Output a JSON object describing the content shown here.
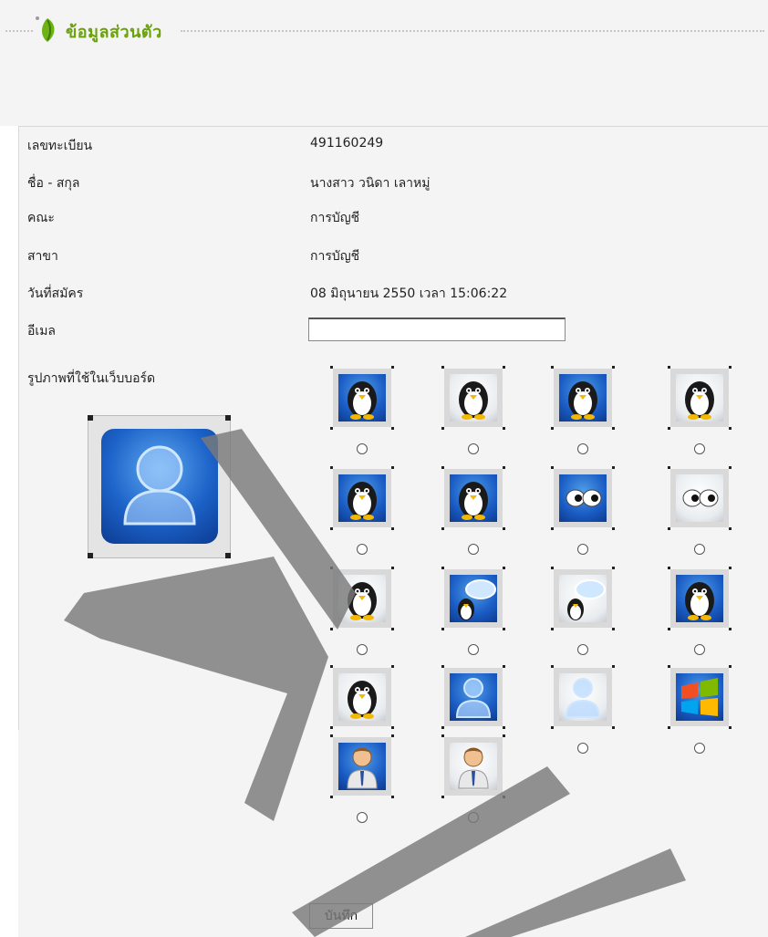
{
  "header": {
    "title": "ข้อมูลส่วนตัว"
  },
  "profile": {
    "fields": [
      {
        "label": "เลขทะเบียน",
        "value": "491160249"
      },
      {
        "label": "ชื่อ - สกุล",
        "value": "นางสาว วนิดา เลาหมู่"
      },
      {
        "label": "คณะ",
        "value": "การบัญชี"
      },
      {
        "label": "สาขา",
        "value": "การบัญชี"
      },
      {
        "label": "วันที่สมัคร",
        "value": "08 มิถุนายน 2550 เวลา 15:06:22"
      }
    ],
    "email_label": "อีเมล",
    "email_value": "",
    "avatar_label": "รูปภาพที่ใช้ในเว็บบอร์ด"
  },
  "avatars": [
    {
      "name": "penguin-sitting-icon",
      "theme": "blue"
    },
    {
      "name": "penguin-sitting-icon",
      "theme": "light"
    },
    {
      "name": "penguin-icon",
      "theme": "blue"
    },
    {
      "name": "penguin-icon",
      "theme": "light"
    },
    {
      "name": "penguin-standing-icon",
      "theme": "blue"
    },
    {
      "name": "penguin-peek-icon",
      "theme": "blue"
    },
    {
      "name": "eyes-icon",
      "theme": "blue"
    },
    {
      "name": "eyes-icon",
      "theme": "light"
    },
    {
      "name": "penguin-peek-icon",
      "theme": "light"
    },
    {
      "name": "penguin-speech-bubble-icon",
      "theme": "blue"
    },
    {
      "name": "penguin-speech-bubble-icon",
      "theme": "light"
    },
    {
      "name": "tux-icon",
      "theme": "blue"
    },
    {
      "name": "tux-icon",
      "theme": "light"
    },
    {
      "name": "user-silhouette-icon",
      "theme": "blue"
    },
    {
      "name": "user-silhouette-icon",
      "theme": "light"
    },
    {
      "name": "windows-logo-icon",
      "theme": "blue"
    },
    {
      "name": "businessman-icon",
      "theme": "blue"
    },
    {
      "name": "businessman-icon",
      "theme": "light"
    }
  ],
  "buttons": {
    "save_label": "บันทึก"
  },
  "colors": {
    "title": "#6aa20a",
    "panel": "#f4f4f4",
    "avatar_blue": "#1a5cc4"
  }
}
